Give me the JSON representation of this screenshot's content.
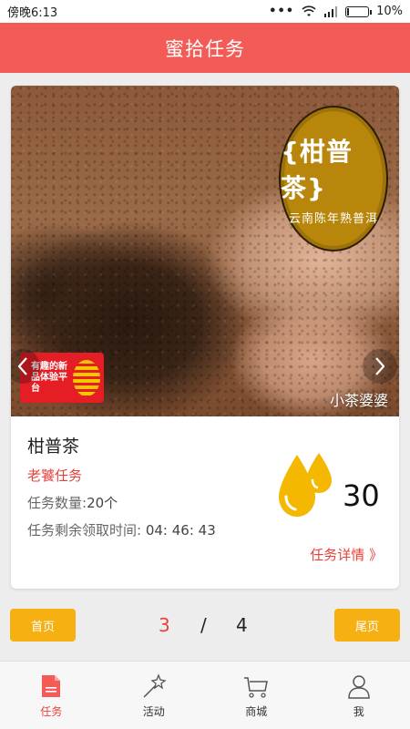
{
  "status_bar": {
    "time": "傍晚6:13",
    "signal_dots": "•••",
    "battery": "10%",
    "battery_level": 0.1
  },
  "header": {
    "title": "蜜拾任务"
  },
  "task_card": {
    "banner": {
      "seal_title": "{柑普茶}",
      "seal_subtitle": "云南陈年熟普洱",
      "brand_logo_text": "有趣的新品体验平台",
      "watermark": "小茶婆婆",
      "prev_icon": "chevron-left-icon",
      "next_icon": "chevron-right-icon"
    },
    "title": "柑普茶",
    "task_type": "老饕任务",
    "count_label": "任务数量:",
    "count_value": "20个",
    "time_label": "任务剩余领取时间:",
    "time_value": "04: 46: 43",
    "reward_icon": "drops-icon",
    "reward_value": "30",
    "detail_link": "任务详情 》"
  },
  "pager": {
    "first": "首页",
    "current": "3",
    "separator": "/",
    "total": "4",
    "last": "尾页"
  },
  "tab_bar": {
    "items": [
      {
        "label": "任务",
        "icon": "task-doc-icon",
        "active": true
      },
      {
        "label": "活动",
        "icon": "magic-wand-icon",
        "active": false
      },
      {
        "label": "商城",
        "icon": "cart-icon",
        "active": false
      },
      {
        "label": "我",
        "icon": "person-icon",
        "active": false
      }
    ]
  },
  "colors": {
    "accent_red": "#f25b56",
    "highlight_red": "#e8413b",
    "button_yellow": "#f6b012",
    "drop_yellow": "#f5b800"
  }
}
